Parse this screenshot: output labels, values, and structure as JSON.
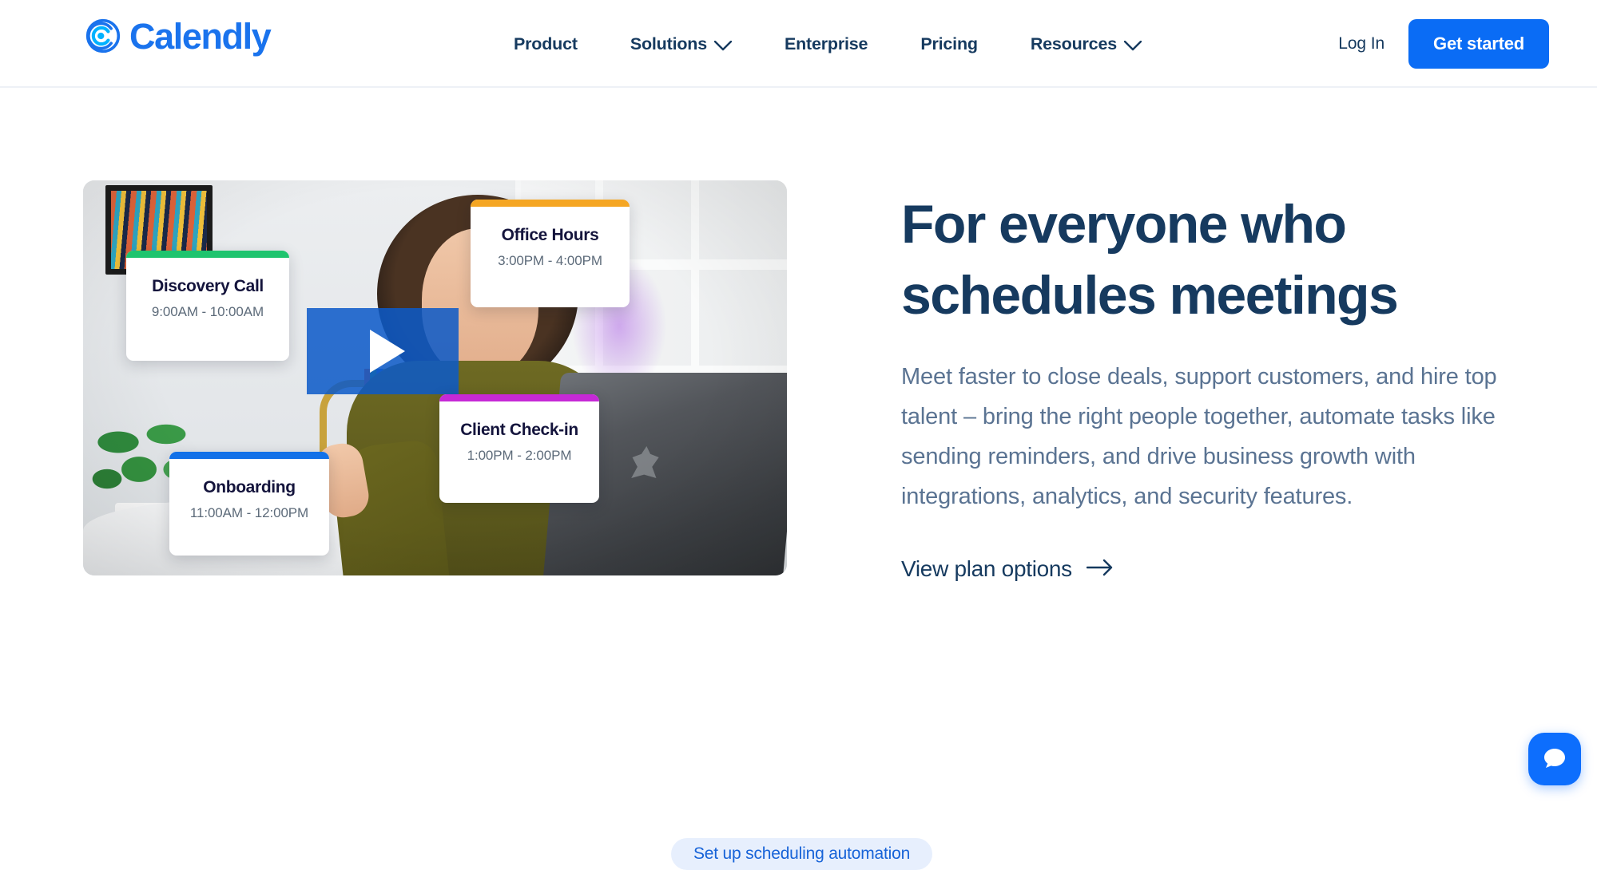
{
  "brand": {
    "name": "Calendly",
    "logo_icon": "calendly-circle-logo",
    "color": "#1a73ed"
  },
  "nav": {
    "items": [
      {
        "label": "Product",
        "has_dropdown": false,
        "icon": ""
      },
      {
        "label": "Solutions",
        "has_dropdown": true,
        "icon": "chevron-down-icon"
      },
      {
        "label": "Enterprise",
        "has_dropdown": false,
        "icon": ""
      },
      {
        "label": "Pricing",
        "has_dropdown": false,
        "icon": ""
      },
      {
        "label": "Resources",
        "has_dropdown": true,
        "icon": "chevron-down-icon"
      }
    ],
    "login_label": "Log In",
    "cta_label": "Get started",
    "cta_color": "#0a6cf5"
  },
  "hero": {
    "title_line1": "For everyone who",
    "title_line2": "schedules meetings",
    "subtitle": "Meet faster to close deals, support customers, and hire top talent – bring the right people together, automate tasks like sending reminders, and drive business growth with integrations, analytics, and security features.",
    "plan_link_label": "View plan options",
    "plan_link_icon": "arrow-right-icon",
    "title_color": "#163a5f",
    "subtitle_color": "#5a7392"
  },
  "video": {
    "play_icon": "play-triangle-icon",
    "overlay_color": "#0c5ac8",
    "event_cards": [
      {
        "title": "Discovery Call",
        "time": "9:00AM - 10:00AM",
        "accent": "#1ec46e"
      },
      {
        "title": "Office Hours",
        "time": "3:00PM - 4:00PM",
        "accent": "#f5a623"
      },
      {
        "title": "Client Check-in",
        "time": "1:00PM - 2:00PM",
        "accent": "#c629d6"
      },
      {
        "title": "Onboarding",
        "time": "11:00AM - 12:00PM",
        "accent": "#1271e8"
      }
    ]
  },
  "footer": {
    "pill_label": "Set up scheduling automation",
    "pill_bg": "#e7effd",
    "pill_text_color": "#1763d8"
  },
  "chat": {
    "icon": "chat-bubble-icon",
    "color": "#0d6efd"
  }
}
